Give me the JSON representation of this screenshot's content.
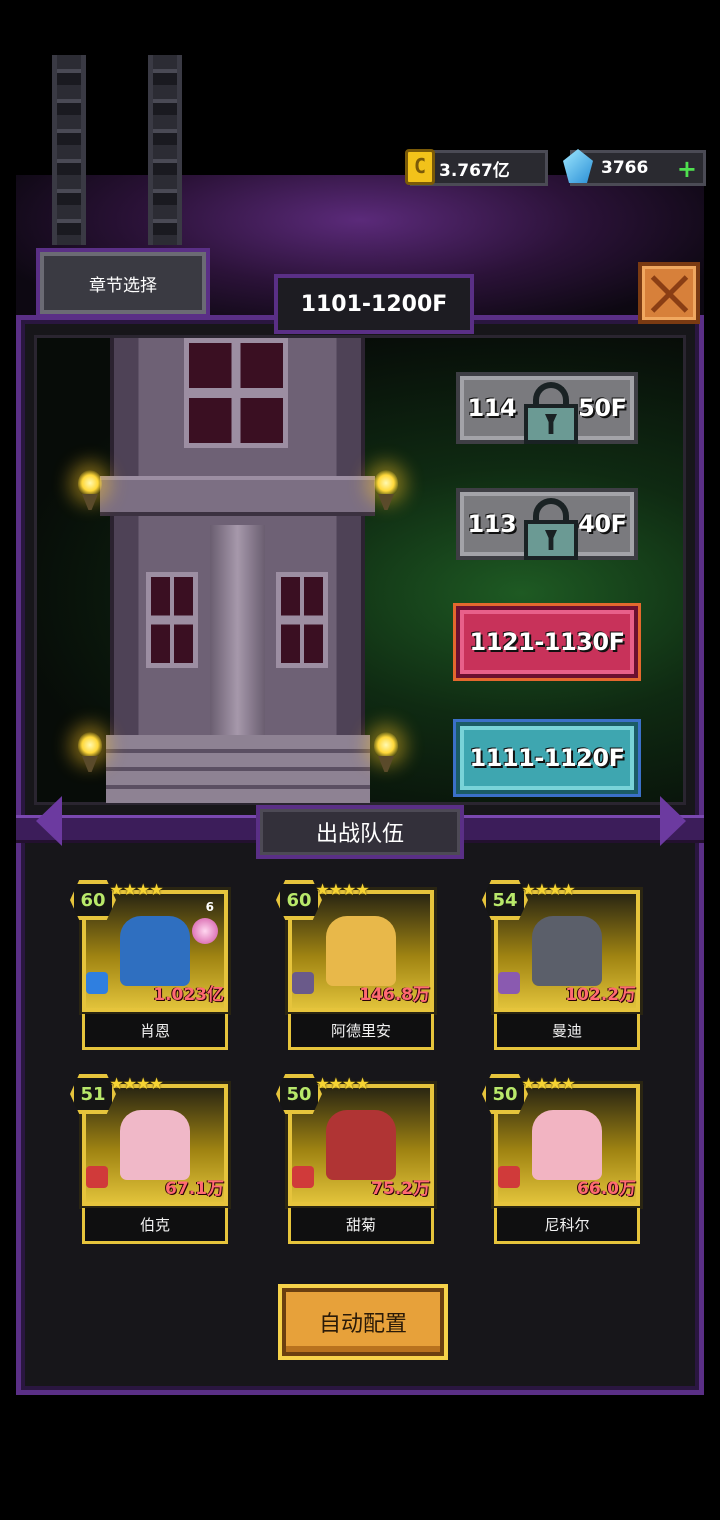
{
  "currency": {
    "gold_value": "3.767亿",
    "gem_value": "3766",
    "gold_icon": "gold-coin-icon",
    "gem_icon": "diamond-icon",
    "plus_icon": "plus-icon",
    "plus_label": "+"
  },
  "header": {
    "chapter_select_label": "章节选择",
    "floor_range_title": "1101-1200F",
    "close_icon": "close-icon"
  },
  "floors": [
    {
      "label": "114□50F",
      "prefix": "114",
      "suffix": "50F",
      "state": "locked"
    },
    {
      "label": "113□40F",
      "prefix": "113",
      "suffix": "40F",
      "state": "locked"
    },
    {
      "label": "1121-1130F",
      "state": "current"
    },
    {
      "label": "1111-1120F",
      "state": "cleared"
    }
  ],
  "team": {
    "title": "出战队伍",
    "heroes": [
      {
        "level": "60",
        "name": "肖恩",
        "power": "1.023亿",
        "class_icon": "lightning-icon",
        "badge_count": "6",
        "stars": 5
      },
      {
        "level": "60",
        "name": "阿德里安",
        "power": "146.8万",
        "class_icon": "axe-icon",
        "stars": 5
      },
      {
        "level": "54",
        "name": "曼迪",
        "power": "102.2万",
        "class_icon": "sword-icon",
        "stars": 5
      },
      {
        "level": "51",
        "name": "伯克",
        "power": "67.1万",
        "class_icon": "heart-icon",
        "stars": 5
      },
      {
        "level": "50",
        "name": "甜菊",
        "power": "75.2万",
        "class_icon": "heart-icon",
        "stars": 5
      },
      {
        "level": "50",
        "name": "尼科尔",
        "power": "66.0万",
        "class_icon": "heart-icon",
        "stars": 5
      }
    ],
    "stars_glyph": "★★★★★"
  },
  "actions": {
    "auto_config_label": "自动配置"
  },
  "colors": {
    "panel_border": "#5a2f86",
    "card_gold": "#e6c43c",
    "power_red": "#ff6a72",
    "level_green": "#b8e86a",
    "floor_current": "#c8325a",
    "floor_cleared": "#3ea6b0",
    "floor_locked": "#7a7a7e"
  }
}
